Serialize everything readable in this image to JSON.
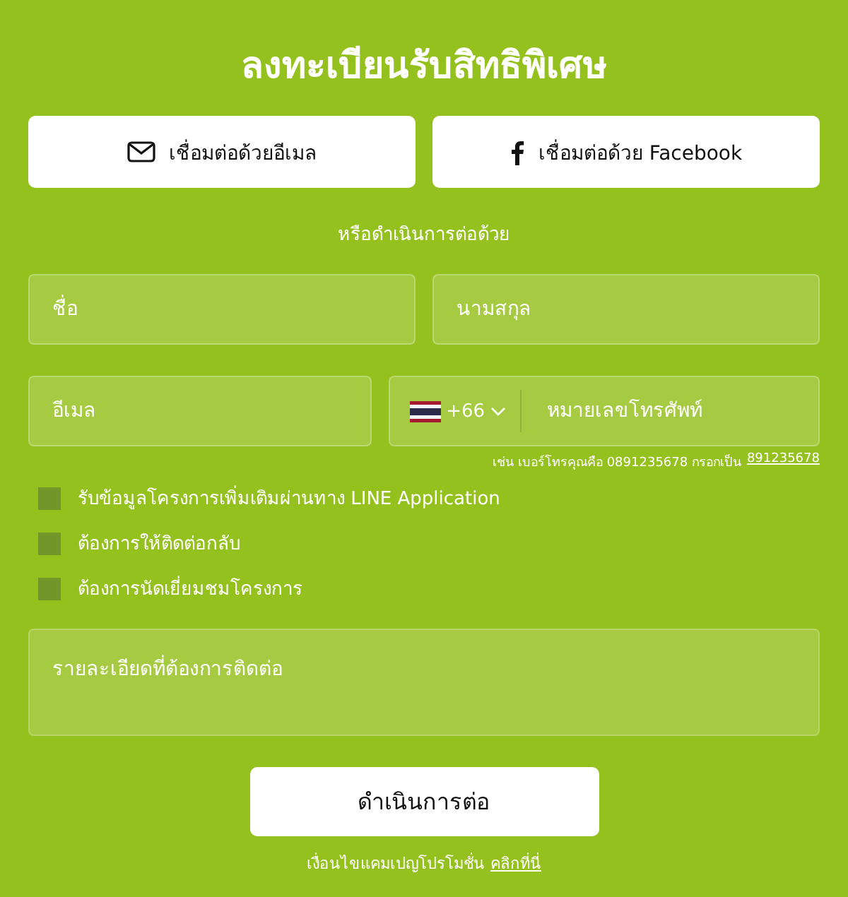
{
  "title": "ลงทะเบียนรับสิทธิพิเศษ",
  "connect_buttons": [
    {
      "kind": "email",
      "label": "เชื่อมต่อด้วยอีเมล"
    },
    {
      "kind": "facebook",
      "label": "เชื่อมต่อด้วย Facebook"
    }
  ],
  "divider_text": "หรือดำเนินการต่อด้วย",
  "fields": {
    "first_name": {
      "placeholder": "ชื่อ"
    },
    "last_name": {
      "placeholder": "นามสกุล"
    },
    "email": {
      "placeholder": "อีเมล"
    },
    "phone": {
      "country_code": "+66",
      "placeholder": "หมายเลขโทรศัพท์",
      "hint": "เช่น เบอร์โทรคุณคือ 0891235678 กรอกเป็น",
      "hint_example": "891235678"
    }
  },
  "options": [
    {
      "label": "รับข้อมูลโครงการเพิ่มเติมผ่านทาง LINE Application",
      "checked": false
    },
    {
      "label": "ต้องการให้ติดต่อกลับ",
      "checked": false
    },
    {
      "label": "ต้องการนัดเยี่ยมชมโครงการ",
      "checked": false
    }
  ],
  "details": {
    "placeholder": "รายละเอียดที่ต้องการติดต่อ"
  },
  "submit": "ดำเนินการต่อ",
  "footer": {
    "text": "เงื่อนไขแคมเปญโปรโมชั่น",
    "link": "คลิกที่นี่"
  }
}
